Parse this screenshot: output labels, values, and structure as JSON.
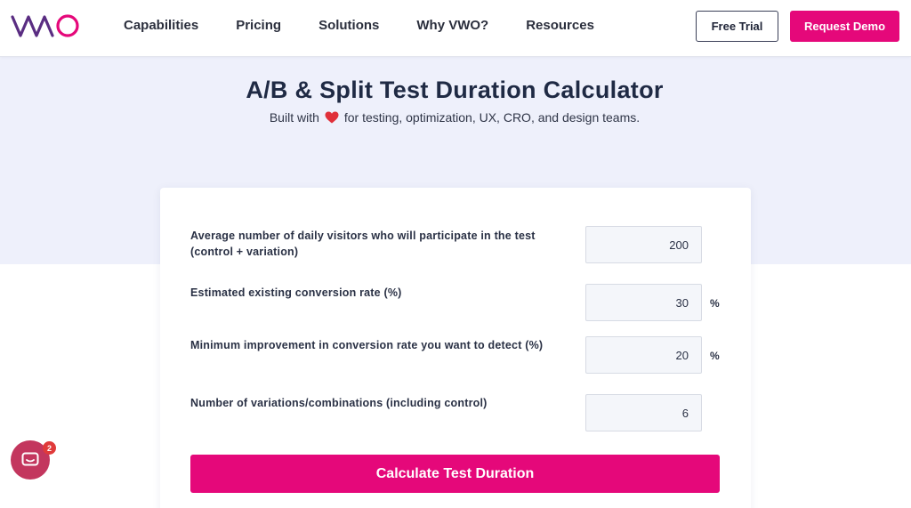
{
  "nav": {
    "logo_alt": "VWO",
    "links": [
      "Capabilities",
      "Pricing",
      "Solutions",
      "Why VWO?",
      "Resources"
    ],
    "free_trial": "Free Trial",
    "request_demo": "Request Demo"
  },
  "hero": {
    "title": "A/B & Split Test Duration Calculator",
    "subtitle_before": "Built with",
    "subtitle_after": "for testing, optimization, UX, CRO, and design teams."
  },
  "calculator": {
    "fields": [
      {
        "label": "Average number of daily visitors who will participate in the test (control + variation)",
        "value": "200",
        "unit": ""
      },
      {
        "label": "Estimated existing conversion rate (%)",
        "value": "30",
        "unit": "%"
      },
      {
        "label": "Minimum improvement in conversion rate you want to detect (%)",
        "value": "20",
        "unit": "%"
      },
      {
        "label": "Number of variations/combinations (including control)",
        "value": "6",
        "unit": ""
      }
    ],
    "submit_label": "Calculate Test Duration"
  },
  "chat": {
    "badge_count": "2"
  },
  "colors": {
    "brand_pink": "#e5087a",
    "hero_bg": "#eef0fb",
    "logo_purple": "#5a2d82"
  },
  "icons": [
    "vwo-logo",
    "heart-icon",
    "chat-icon"
  ]
}
